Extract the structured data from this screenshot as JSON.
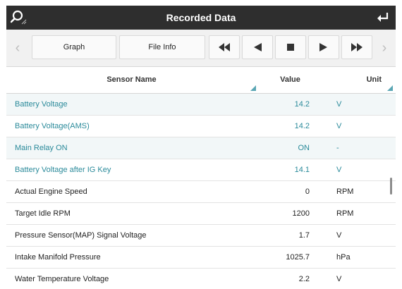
{
  "header": {
    "title": "Recorded Data",
    "search_icon": "search-icon",
    "back_icon": "return-icon"
  },
  "toolbar": {
    "graph_label": "Graph",
    "file_info_label": "File Info",
    "controls": [
      "fast-rewind-icon",
      "step-back-icon",
      "stop-icon",
      "play-icon",
      "fast-forward-icon"
    ]
  },
  "table": {
    "columns": {
      "sensor": "Sensor Name",
      "value": "Value",
      "unit": "Unit"
    },
    "rows": [
      {
        "name": "Battery Voltage",
        "value": "14.2",
        "unit": "V",
        "style": "teal"
      },
      {
        "name": "Battery Voltage(AMS)",
        "value": "14.2",
        "unit": "V",
        "style": "teal"
      },
      {
        "name": "Main Relay ON",
        "value": "ON",
        "unit": "-",
        "style": "teal"
      },
      {
        "name": "Battery Voltage after IG Key",
        "value": "14.1",
        "unit": "V",
        "style": "teal"
      },
      {
        "name": "Actual Engine Speed",
        "value": "0",
        "unit": "RPM",
        "style": "dark"
      },
      {
        "name": "Target Idle RPM",
        "value": "1200",
        "unit": "RPM",
        "style": "dark"
      },
      {
        "name": "Pressure Sensor(MAP) Signal Voltage",
        "value": "1.7",
        "unit": "V",
        "style": "dark"
      },
      {
        "name": "Intake Manifold Pressure",
        "value": "1025.7",
        "unit": "hPa",
        "style": "dark"
      },
      {
        "name": "Water Temperature Voltage",
        "value": "2.2",
        "unit": "V",
        "style": "dark"
      }
    ]
  },
  "colors": {
    "titlebar": "#2e2e2e",
    "accent": "#2a8a9a",
    "highlight_row": "#f2f7f8"
  }
}
